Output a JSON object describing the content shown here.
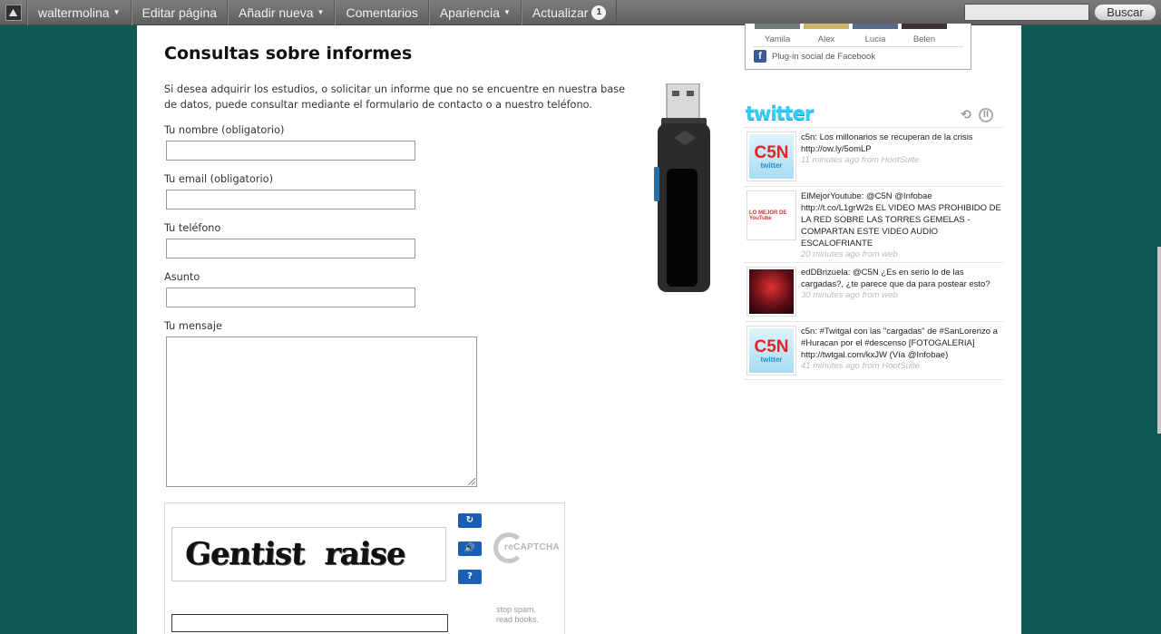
{
  "adminbar": {
    "user": "waltermolina",
    "edit": "Editar página",
    "add_new": "Añadir nueva",
    "comments": "Comentarios",
    "appearance": "Apariencia",
    "update": "Actualizar",
    "update_count": "1",
    "search_button": "Buscar"
  },
  "page": {
    "title": "Consultas sobre informes",
    "intro": "Si desea adquirir los estudios, o solicitar un informe que no se encuentre en nuestra base de datos, puede consultar mediante el formulario de contacto o a nuestro teléfono.",
    "form": {
      "name_label": "Tu nombre (obligatorio)",
      "email_label": "Tu email (obligatorio)",
      "phone_label": "Tu teléfono",
      "subject_label": "Asunto",
      "message_label": "Tu mensaje"
    },
    "recaptcha": {
      "word1": "Gentist",
      "word2": "raise",
      "logo_text": "reCAPTCHA",
      "tag_line1": "stop spam.",
      "tag_line2": "read books."
    }
  },
  "sidebar": {
    "facebook": {
      "faces": [
        "Yamila",
        "Alex",
        "Lucia",
        "Belen"
      ],
      "plugin_text": "Plug-in social de Facebook"
    },
    "twitter": {
      "logo": "twitter",
      "tweets": [
        {
          "text": "c5n: Los millonarios se recuperan de la crisis http://ow.ly/5omLP",
          "meta": "11 minutes ago from HootSuite",
          "avatar": "c5n"
        },
        {
          "text": "ElMejorYoutube: @C5N @Infobae http://t.co/L1grW2s EL VIDEO MAS PROHIBIDO DE LA RED SOBRE LAS TORRES GEMELAS - COMPARTAN ESTE VIDEO AUDIO ESCALOFRIANTE",
          "meta": "20 minutes ago from web",
          "avatar": "youtube"
        },
        {
          "text": "edDBrizuela: @C5N ¿Es en serio lo de las cargadas?, ¿te parece que da para postear esto?",
          "meta": "30 minutes ago from web",
          "avatar": "red"
        },
        {
          "text": "c5n: #Twitgal con las \"cargadas\" de #SanLorenzo a #Huracan por el #descenso [FOTOGALERIA] http://twtgal.com/kxJW (Vía @Infobae)",
          "meta": "41 minutes ago from HootSuite",
          "avatar": "c5n"
        }
      ],
      "c5n_avatar_big": "C5N",
      "c5n_avatar_small": "twitter",
      "yt_avatar_text": "LO MEJOR DE YouTube"
    }
  }
}
